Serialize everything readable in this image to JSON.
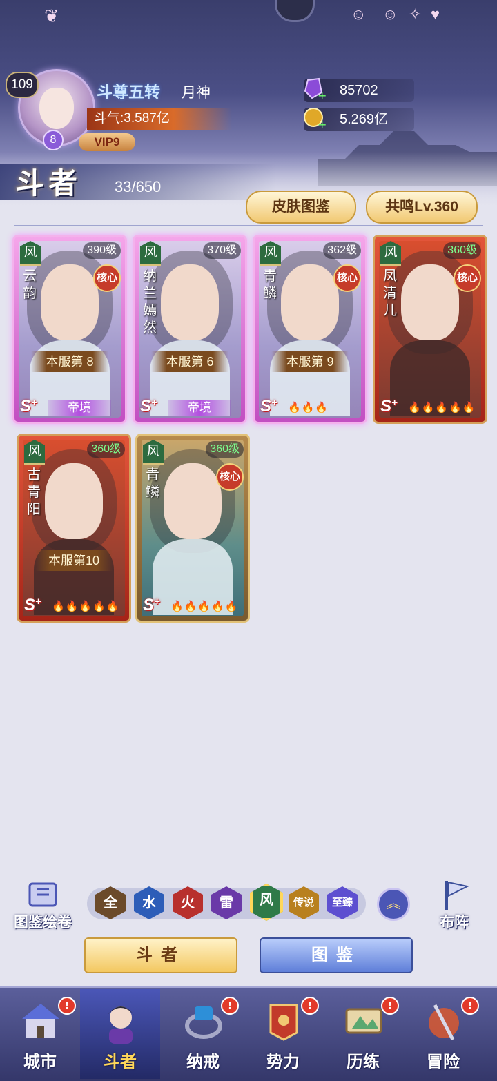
{
  "header": {
    "level": "109",
    "rank_badge": "8",
    "vip": "VIP9",
    "title": "斗尊五转",
    "name": "月神",
    "power": "斗气:3.587亿",
    "gems": "85702",
    "gold": "5.269亿"
  },
  "section": {
    "title": "斗者",
    "count": "33/650",
    "skin_button": "皮肤图鉴",
    "resonance_button": "共鸣Lv.360"
  },
  "cards": [
    {
      "element": "风",
      "level": "390级",
      "name": "云韵",
      "core": "核心",
      "server_rank": "本服第 8",
      "grade": "S",
      "realm": "帝境",
      "theme": "pink"
    },
    {
      "element": "风",
      "level": "370级",
      "name": "纳兰嫣然",
      "core": "",
      "server_rank": "本服第 6",
      "grade": "S",
      "realm": "帝境",
      "theme": "pink"
    },
    {
      "element": "风",
      "level": "362级",
      "name": "青鳞",
      "core": "核心",
      "server_rank": "本服第 9",
      "grade": "S",
      "stars": 3,
      "theme": "pink"
    },
    {
      "element": "风",
      "level": "360级",
      "name": "凤清儿",
      "core": "核心",
      "server_rank": "",
      "grade": "S",
      "stars": 5,
      "theme": "red"
    },
    {
      "element": "风",
      "level": "360级",
      "name": "古青阳",
      "core": "",
      "server_rank": "本服第10",
      "grade": "S",
      "stars": 5,
      "theme": "red"
    },
    {
      "element": "风",
      "level": "360级",
      "name": "青鳞",
      "core": "核心",
      "server_rank": "",
      "grade": "S",
      "stars": 5,
      "theme": "gold"
    }
  ],
  "filters": {
    "atlas_label": "图鉴绘卷",
    "formation_label": "布阵",
    "tags": [
      {
        "label": "全",
        "color": "#6b4a2a"
      },
      {
        "label": "水",
        "color": "#2d5db8"
      },
      {
        "label": "火",
        "color": "#b8302d"
      },
      {
        "label": "雷",
        "color": "#6a3aa8"
      },
      {
        "label": "风",
        "color": "#2f7a48"
      },
      {
        "label": "传说",
        "color": "#b8801f"
      },
      {
        "label": "至臻",
        "color": "#5d4fd0"
      }
    ],
    "selected": "风",
    "up_glyph": "︽"
  },
  "buttons": {
    "fighters": "斗者",
    "atlas": "图鉴"
  },
  "nav": [
    {
      "label": "城市",
      "badge": "!"
    },
    {
      "label": "斗者",
      "badge": ""
    },
    {
      "label": "纳戒",
      "badge": "!"
    },
    {
      "label": "势力",
      "badge": "!"
    },
    {
      "label": "历练",
      "badge": "!"
    },
    {
      "label": "冒险",
      "badge": "!"
    }
  ],
  "colors": {
    "accent_gold": "#f3c861",
    "nav_bg": "#34376a",
    "active_label": "#ffd75a"
  }
}
